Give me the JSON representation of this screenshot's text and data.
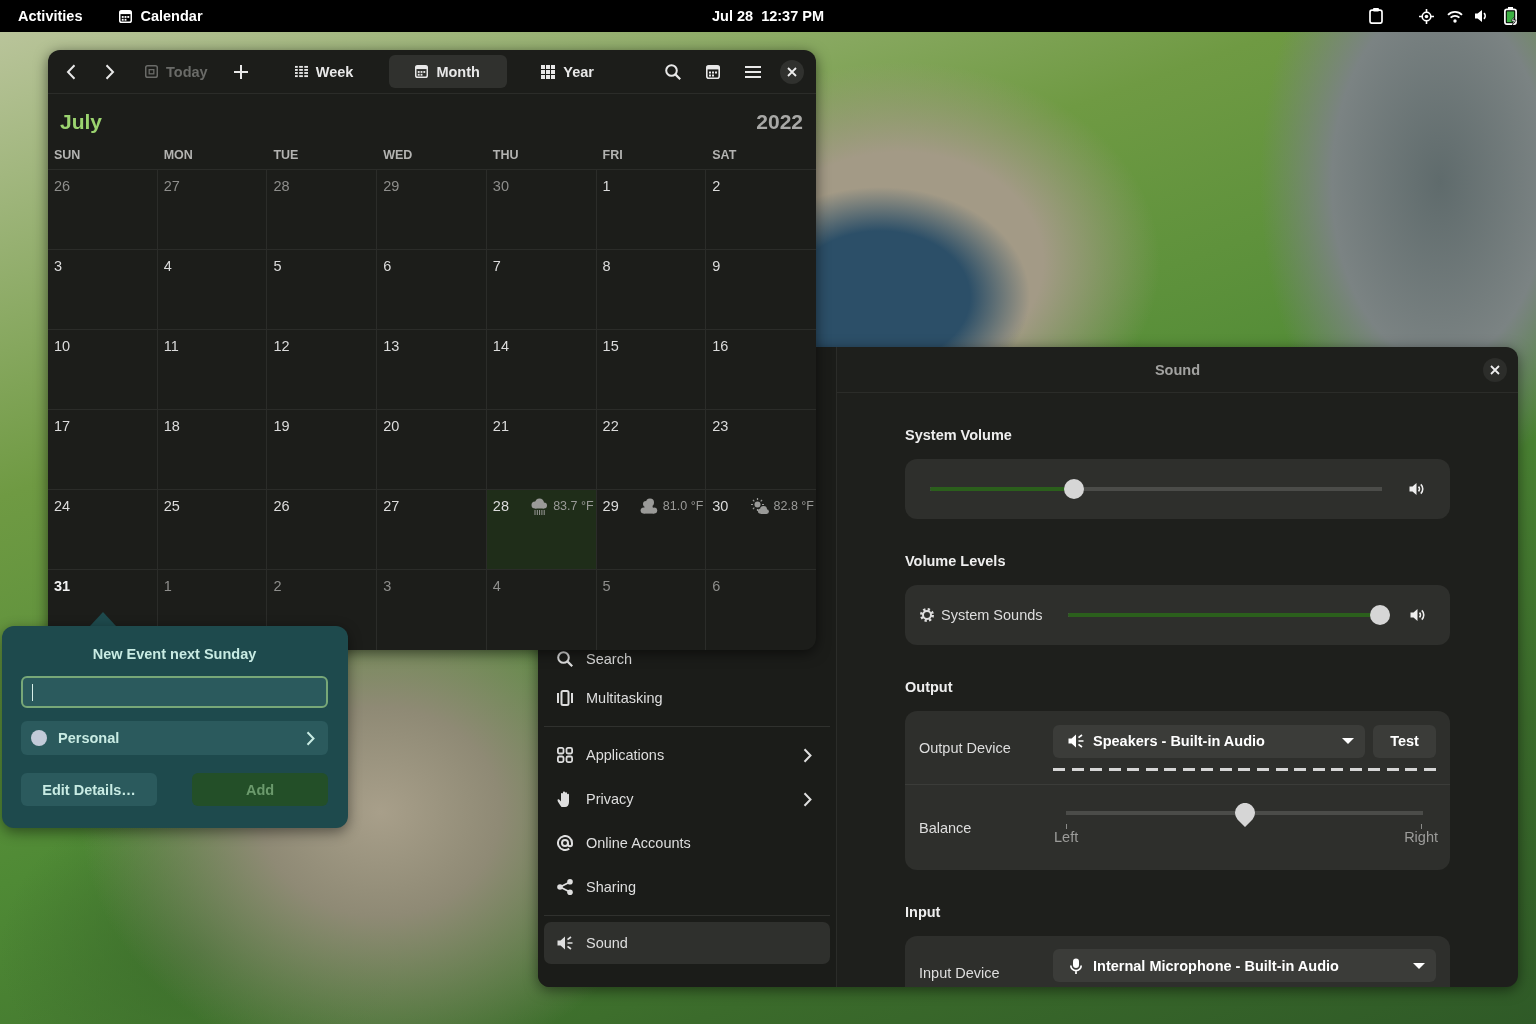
{
  "top_bar": {
    "activities": "Activities",
    "app_menu": "Calendar",
    "clock": "Jul 28  12:37 PM"
  },
  "calendar_window": {
    "toolbar": {
      "today": {
        "label": "Today",
        "disabled": true
      },
      "views": [
        {
          "label": "Week",
          "selected": false
        },
        {
          "label": "Month",
          "selected": true
        },
        {
          "label": "Year",
          "selected": false
        }
      ]
    },
    "month": "July",
    "year": "2022",
    "weekdays": [
      "SUN",
      "MON",
      "TUE",
      "WED",
      "THU",
      "FRI",
      "SAT"
    ],
    "weeks": [
      {
        "days": [
          {
            "day": "26",
            "dimmed": true,
            "today": false,
            "selected": false
          },
          {
            "day": "27",
            "dimmed": true,
            "today": false,
            "selected": false
          },
          {
            "day": "28",
            "dimmed": true,
            "today": false,
            "selected": false
          },
          {
            "day": "29",
            "dimmed": true,
            "today": false,
            "selected": false
          },
          {
            "day": "30",
            "dimmed": true,
            "today": false,
            "selected": false
          },
          {
            "day": "1",
            "dimmed": false,
            "today": false,
            "selected": false
          },
          {
            "day": "2",
            "dimmed": false,
            "today": false,
            "selected": false
          }
        ]
      },
      {
        "days": [
          {
            "day": "3",
            "dimmed": false,
            "today": false,
            "selected": false
          },
          {
            "day": "4",
            "dimmed": false,
            "today": false,
            "selected": false
          },
          {
            "day": "5",
            "dimmed": false,
            "today": false,
            "selected": false
          },
          {
            "day": "6",
            "dimmed": false,
            "today": false,
            "selected": false
          },
          {
            "day": "7",
            "dimmed": false,
            "today": false,
            "selected": false
          },
          {
            "day": "8",
            "dimmed": false,
            "today": false,
            "selected": false
          },
          {
            "day": "9",
            "dimmed": false,
            "today": false,
            "selected": false
          }
        ]
      },
      {
        "days": [
          {
            "day": "10",
            "dimmed": false,
            "today": false,
            "selected": false
          },
          {
            "day": "11",
            "dimmed": false,
            "today": false,
            "selected": false
          },
          {
            "day": "12",
            "dimmed": false,
            "today": false,
            "selected": false
          },
          {
            "day": "13",
            "dimmed": false,
            "today": false,
            "selected": false
          },
          {
            "day": "14",
            "dimmed": false,
            "today": false,
            "selected": false
          },
          {
            "day": "15",
            "dimmed": false,
            "today": false,
            "selected": false
          },
          {
            "day": "16",
            "dimmed": false,
            "today": false,
            "selected": false
          }
        ]
      },
      {
        "days": [
          {
            "day": "17",
            "dimmed": false,
            "today": false,
            "selected": false
          },
          {
            "day": "18",
            "dimmed": false,
            "today": false,
            "selected": false
          },
          {
            "day": "19",
            "dimmed": false,
            "today": false,
            "selected": false
          },
          {
            "day": "20",
            "dimmed": false,
            "today": false,
            "selected": false
          },
          {
            "day": "21",
            "dimmed": false,
            "today": false,
            "selected": false
          },
          {
            "day": "22",
            "dimmed": false,
            "today": false,
            "selected": false
          },
          {
            "day": "23",
            "dimmed": false,
            "today": false,
            "selected": false
          }
        ]
      },
      {
        "days": [
          {
            "day": "24",
            "dimmed": false,
            "today": false,
            "selected": false
          },
          {
            "day": "25",
            "dimmed": false,
            "today": false,
            "selected": false
          },
          {
            "day": "26",
            "dimmed": false,
            "today": false,
            "selected": false
          },
          {
            "day": "27",
            "dimmed": false,
            "today": false,
            "selected": false
          },
          {
            "day": "28",
            "dimmed": false,
            "today": true,
            "selected": false,
            "weather": {
              "kind": "rain",
              "temp": "83.7 °F"
            }
          },
          {
            "day": "29",
            "dimmed": false,
            "today": false,
            "selected": false,
            "weather": {
              "kind": "cloudy",
              "temp": "81.0 °F"
            }
          },
          {
            "day": "30",
            "dimmed": false,
            "today": false,
            "selected": false,
            "weather": {
              "kind": "partly-cloudy",
              "temp": "82.8 °F"
            }
          }
        ]
      },
      {
        "days": [
          {
            "day": "31",
            "dimmed": false,
            "today": false,
            "selected": true
          },
          {
            "day": "1",
            "dimmed": true,
            "today": false,
            "selected": false
          },
          {
            "day": "2",
            "dimmed": true,
            "today": false,
            "selected": false
          },
          {
            "day": "3",
            "dimmed": true,
            "today": false,
            "selected": false
          },
          {
            "day": "4",
            "dimmed": true,
            "today": false,
            "selected": false
          },
          {
            "day": "5",
            "dimmed": true,
            "today": false,
            "selected": false
          },
          {
            "day": "6",
            "dimmed": true,
            "today": false,
            "selected": false
          }
        ]
      }
    ]
  },
  "event_popover": {
    "title": "New Event next Sunday",
    "title_field": {
      "focused": true
    },
    "calendar": {
      "name": "Personal",
      "color": "#c3cbd9"
    },
    "buttons": [
      {
        "label": "Edit Details…",
        "kind": "secondary",
        "disabled": false
      },
      {
        "label": "Add",
        "kind": "primary",
        "disabled": true
      }
    ]
  },
  "settings_window": {
    "sidebar": {
      "groups": [
        {
          "items": [
            {
              "label": "Search",
              "submenu": false,
              "selected": false
            },
            {
              "label": "Multitasking",
              "submenu": false,
              "selected": false
            }
          ]
        },
        {
          "items": [
            {
              "label": "Applications",
              "submenu": true,
              "selected": false
            },
            {
              "label": "Privacy",
              "submenu": true,
              "selected": false
            },
            {
              "label": "Online Accounts",
              "submenu": false,
              "selected": false
            },
            {
              "label": "Sharing",
              "submenu": false,
              "selected": false
            }
          ]
        },
        {
          "items": [
            {
              "label": "Sound",
              "submenu": false,
              "selected": true
            }
          ]
        }
      ]
    },
    "title": "Sound",
    "sections": [
      {
        "heading": "System Volume",
        "kind": "volume",
        "slider": {
          "level": 0.31
        }
      },
      {
        "heading": "Volume Levels",
        "kind": "stream",
        "label": "System Sounds",
        "slider": {
          "level": 1
        }
      },
      {
        "heading": "Output",
        "kind": "output",
        "device_label": "Output Device",
        "device": "Speakers - Built-in Audio",
        "test": "Test",
        "meter": {
          "level": 0
        },
        "balance": {
          "label": "Balance",
          "level": 0.5,
          "left": "Left",
          "right": "Right"
        }
      },
      {
        "heading": "Input",
        "kind": "input",
        "device_label": "Input Device",
        "device": "Internal Microphone - Built-in Audio"
      }
    ]
  }
}
